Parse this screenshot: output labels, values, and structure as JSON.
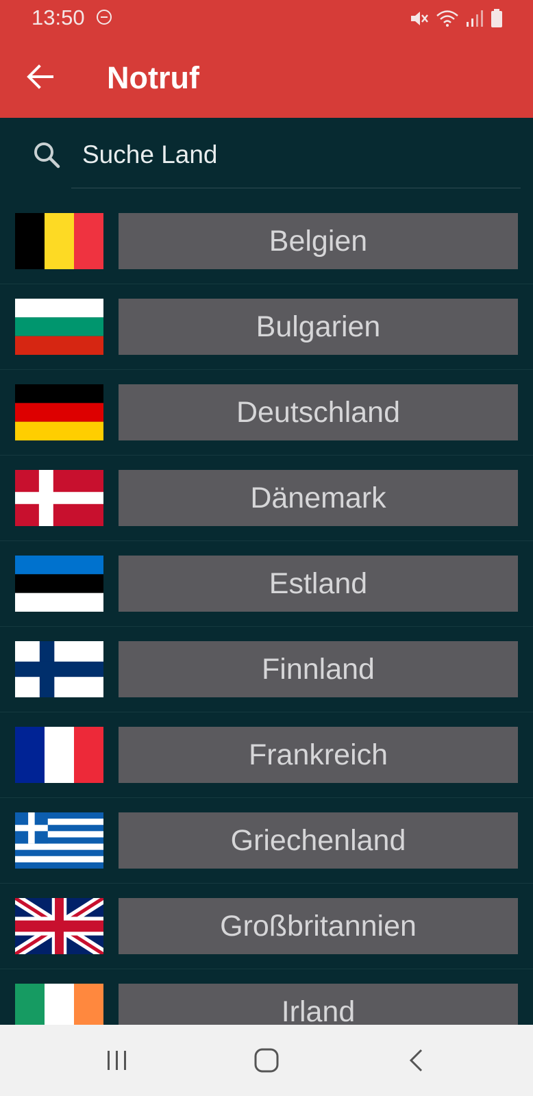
{
  "status_bar": {
    "time": "13:50",
    "icons": [
      "do-not-disturb-icon",
      "mute-icon",
      "wifi-icon",
      "signal-icon",
      "battery-icon"
    ]
  },
  "app_bar": {
    "title": "Notruf",
    "background_color": "#d63c38",
    "back_icon": "arrow-left-icon"
  },
  "search": {
    "placeholder": "Suche Land",
    "value": ""
  },
  "countries": [
    {
      "name": "Belgien",
      "flag": "belgium-flag"
    },
    {
      "name": "Bulgarien",
      "flag": "bulgaria-flag"
    },
    {
      "name": "Deutschland",
      "flag": "germany-flag"
    },
    {
      "name": "Dänemark",
      "flag": "denmark-flag"
    },
    {
      "name": "Estland",
      "flag": "estonia-flag"
    },
    {
      "name": "Finnland",
      "flag": "finland-flag"
    },
    {
      "name": "Frankreich",
      "flag": "france-flag"
    },
    {
      "name": "Griechenland",
      "flag": "greece-flag"
    },
    {
      "name": "Großbritannien",
      "flag": "uk-flag"
    },
    {
      "name": "Irland",
      "flag": "ireland-flag"
    }
  ],
  "nav_bar": {
    "icons": [
      "recent-apps-icon",
      "home-icon",
      "back-nav-icon"
    ]
  },
  "colors": {
    "background": "#072a31",
    "button": "#5b5a5e",
    "button_text": "#d6d6d8"
  }
}
